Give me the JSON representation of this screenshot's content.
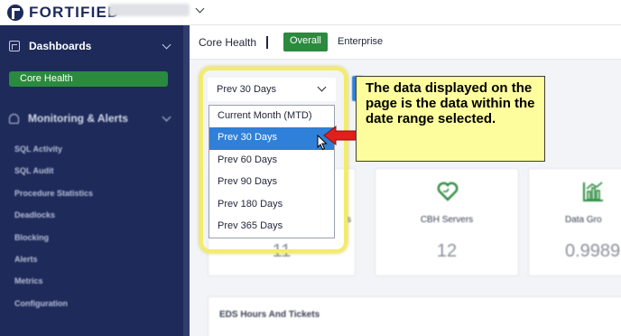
{
  "header": {
    "logo_text": "FORTIFIED"
  },
  "sidebar": {
    "dashboards_label": "Dashboards",
    "core_health_label": "Core Health",
    "monitoring_label": "Monitoring & Alerts",
    "items": [
      {
        "label": "SQL Activity"
      },
      {
        "label": "SQL Audit"
      },
      {
        "label": "Procedure Statistics"
      },
      {
        "label": "Deadlocks"
      },
      {
        "label": "Blocking"
      },
      {
        "label": "Alerts"
      },
      {
        "label": "Metrics"
      },
      {
        "label": "Configuration"
      }
    ]
  },
  "main": {
    "page_title": "Core Health",
    "tabs": [
      {
        "label": "Overall",
        "active": true
      },
      {
        "label": "Enterprise",
        "active": false
      }
    ],
    "date_range": {
      "selected": "Prev 30 Days",
      "options": [
        {
          "label": "Current Month (MTD)",
          "selected": false
        },
        {
          "label": "Prev 30 Days",
          "selected": true
        },
        {
          "label": "Prev 60 Days",
          "selected": false
        },
        {
          "label": "Prev 90 Days",
          "selected": false
        },
        {
          "label": "Prev 180 Days",
          "selected": false
        },
        {
          "label": "Prev 365 Days",
          "selected": false
        }
      ]
    },
    "cards": {
      "left": {
        "label": "s",
        "value": "11"
      },
      "cbh_servers": {
        "label": "CBH Servers",
        "value": "12"
      },
      "data_growth": {
        "label": "Data Gro",
        "value": "0.9989"
      }
    },
    "eds_section_title": "EDS Hours And Tickets"
  },
  "callout": {
    "text": "The data displayed on the page is the data within the date range selected."
  },
  "colors": {
    "sidebar_bg": "#1e2a5a",
    "accent_green": "#2a8a3e",
    "selected_blue": "#2f80d8",
    "callout_bg": "#fdfd9d",
    "highlight_ring": "#f2ec6a",
    "arrow_red": "#e0201c"
  }
}
